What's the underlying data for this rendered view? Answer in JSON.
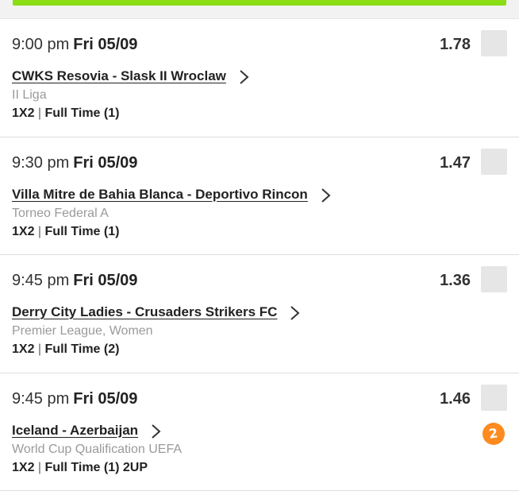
{
  "events": [
    {
      "time": "9:00 pm",
      "date": "Fri 05/09",
      "odds": "1.78",
      "match": "CWKS Resovia - Slask II Wroclaw",
      "league": "II Liga",
      "market_type": "1X2",
      "market_detail": "Full Time (1)",
      "boost": null
    },
    {
      "time": "9:30 pm",
      "date": "Fri 05/09",
      "odds": "1.47",
      "match": "Villa Mitre de Bahia Blanca - Deportivo Rincon",
      "league": "Torneo Federal A",
      "market_type": "1X2",
      "market_detail": "Full Time (1)",
      "boost": null
    },
    {
      "time": "9:45 pm",
      "date": "Fri 05/09",
      "odds": "1.36",
      "match": "Derry City Ladies - Crusaders Strikers FC",
      "league": "Premier League, Women",
      "market_type": "1X2",
      "market_detail": "Full Time (2)",
      "boost": null
    },
    {
      "time": "9:45 pm",
      "date": "Fri 05/09",
      "odds": "1.46",
      "match": "Iceland - Azerbaijan",
      "league": "World Cup Qualification UEFA",
      "market_type": "1X2",
      "market_detail": "Full Time (1) 2UP",
      "boost": "2"
    }
  ],
  "icons": {
    "chevron": "chevron-right-icon",
    "boost": "2up-badge-icon"
  },
  "colors": {
    "accent_bar": "#8bdd14",
    "boost_badge": "#ff8a1f",
    "league_text": "#9a9a9a"
  }
}
